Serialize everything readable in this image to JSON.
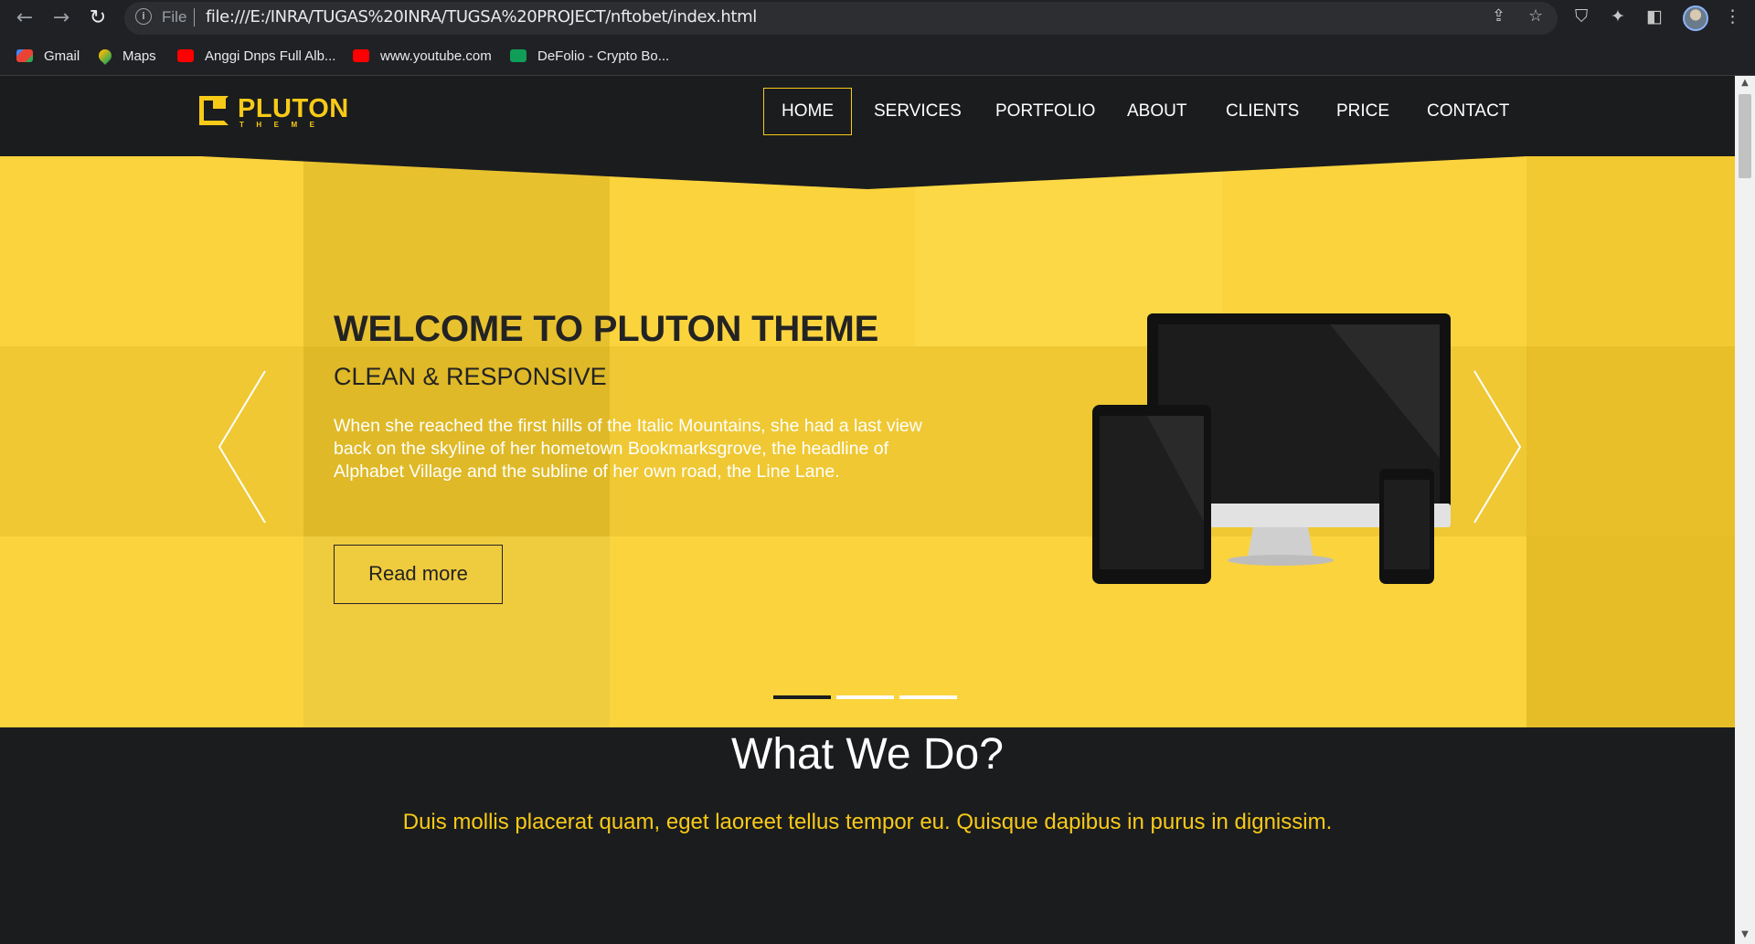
{
  "browser": {
    "url_label": "File",
    "url": "file:///E:/INRA/TUGAS%20INRA/TUGSA%20PROJECT/nftobet/index.html",
    "bookmarks": [
      {
        "label": "Gmail",
        "icon": "gmail-icon",
        "color": "#ea4335"
      },
      {
        "label": "Maps",
        "icon": "maps-icon",
        "color": "#34a853"
      },
      {
        "label": "Anggi Dnps Full Alb...",
        "icon": "youtube-icon",
        "color": "#ff0000"
      },
      {
        "label": "www.youtube.com",
        "icon": "youtube-icon",
        "color": "#ff0000"
      },
      {
        "label": "DeFolio - Crypto Bo...",
        "icon": "sheets-icon",
        "color": "#0f9d58"
      }
    ]
  },
  "site": {
    "logo": {
      "title": "PLUTON",
      "subtitle": "THEME"
    },
    "nav": [
      {
        "label": "HOME",
        "active": true
      },
      {
        "label": "SERVICES"
      },
      {
        "label": "PORTFOLIO"
      },
      {
        "label": "ABOUT"
      },
      {
        "label": "CLIENTS"
      },
      {
        "label": "PRICE"
      },
      {
        "label": "CONTACT"
      }
    ],
    "hero": {
      "title": "WELCOME TO PLUTON THEME",
      "subtitle": "CLEAN & RESPONSIVE",
      "text": "When she reached the first hills of the Italic Mountains, she had a last view back on the skyline of her hometown Bookmarksgrove, the headline of Alphabet Village and the subline of her own road, the Line Lane.",
      "button": "Read more",
      "slides_total": 3,
      "active_slide": 1
    },
    "section": {
      "title": "What We Do?",
      "lead": "Duis mollis placerat quam, eget laoreet tellus tempor eu. Quisque dapibus in purus in dignissim."
    }
  },
  "colors": {
    "accent": "#f7ca18",
    "dark": "#1b1c1e",
    "hero": "#fbd33d"
  }
}
